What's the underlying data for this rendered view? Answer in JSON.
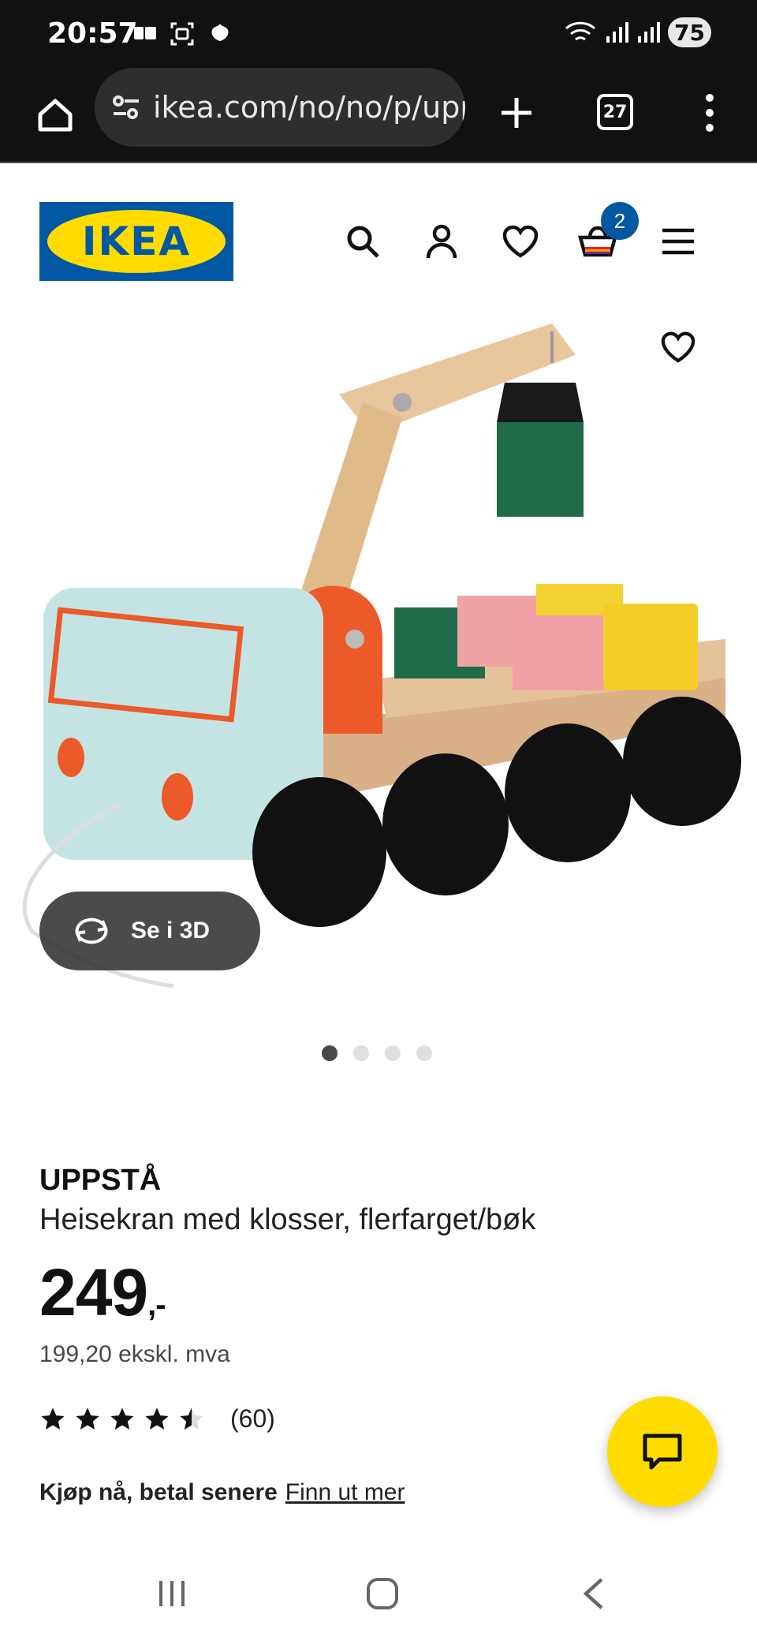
{
  "status_bar": {
    "time": "20:57",
    "battery": "75"
  },
  "browser": {
    "url": "ikea.com/no/no/p/upp",
    "tab_count": "27"
  },
  "header": {
    "logo_text": "IKEA",
    "cart_count": "2"
  },
  "gallery": {
    "view_3d_label": "Se i 3D",
    "image_count": 4,
    "active_index": 0
  },
  "product": {
    "brand": "UPPSTÅ",
    "description": "Heisekran med klosser, flerfarget/bøk",
    "price": "249",
    "price_suffix": ",-",
    "price_ex_vat": "199,20 ekskl. mva",
    "rating": 4.5,
    "review_count": "(60)",
    "bnpl_text": "Kjøp nå, betal senere",
    "bnpl_link": "Finn ut mer"
  },
  "colors": {
    "brand_blue": "#0058a3",
    "brand_yellow": "#ffdb00"
  }
}
